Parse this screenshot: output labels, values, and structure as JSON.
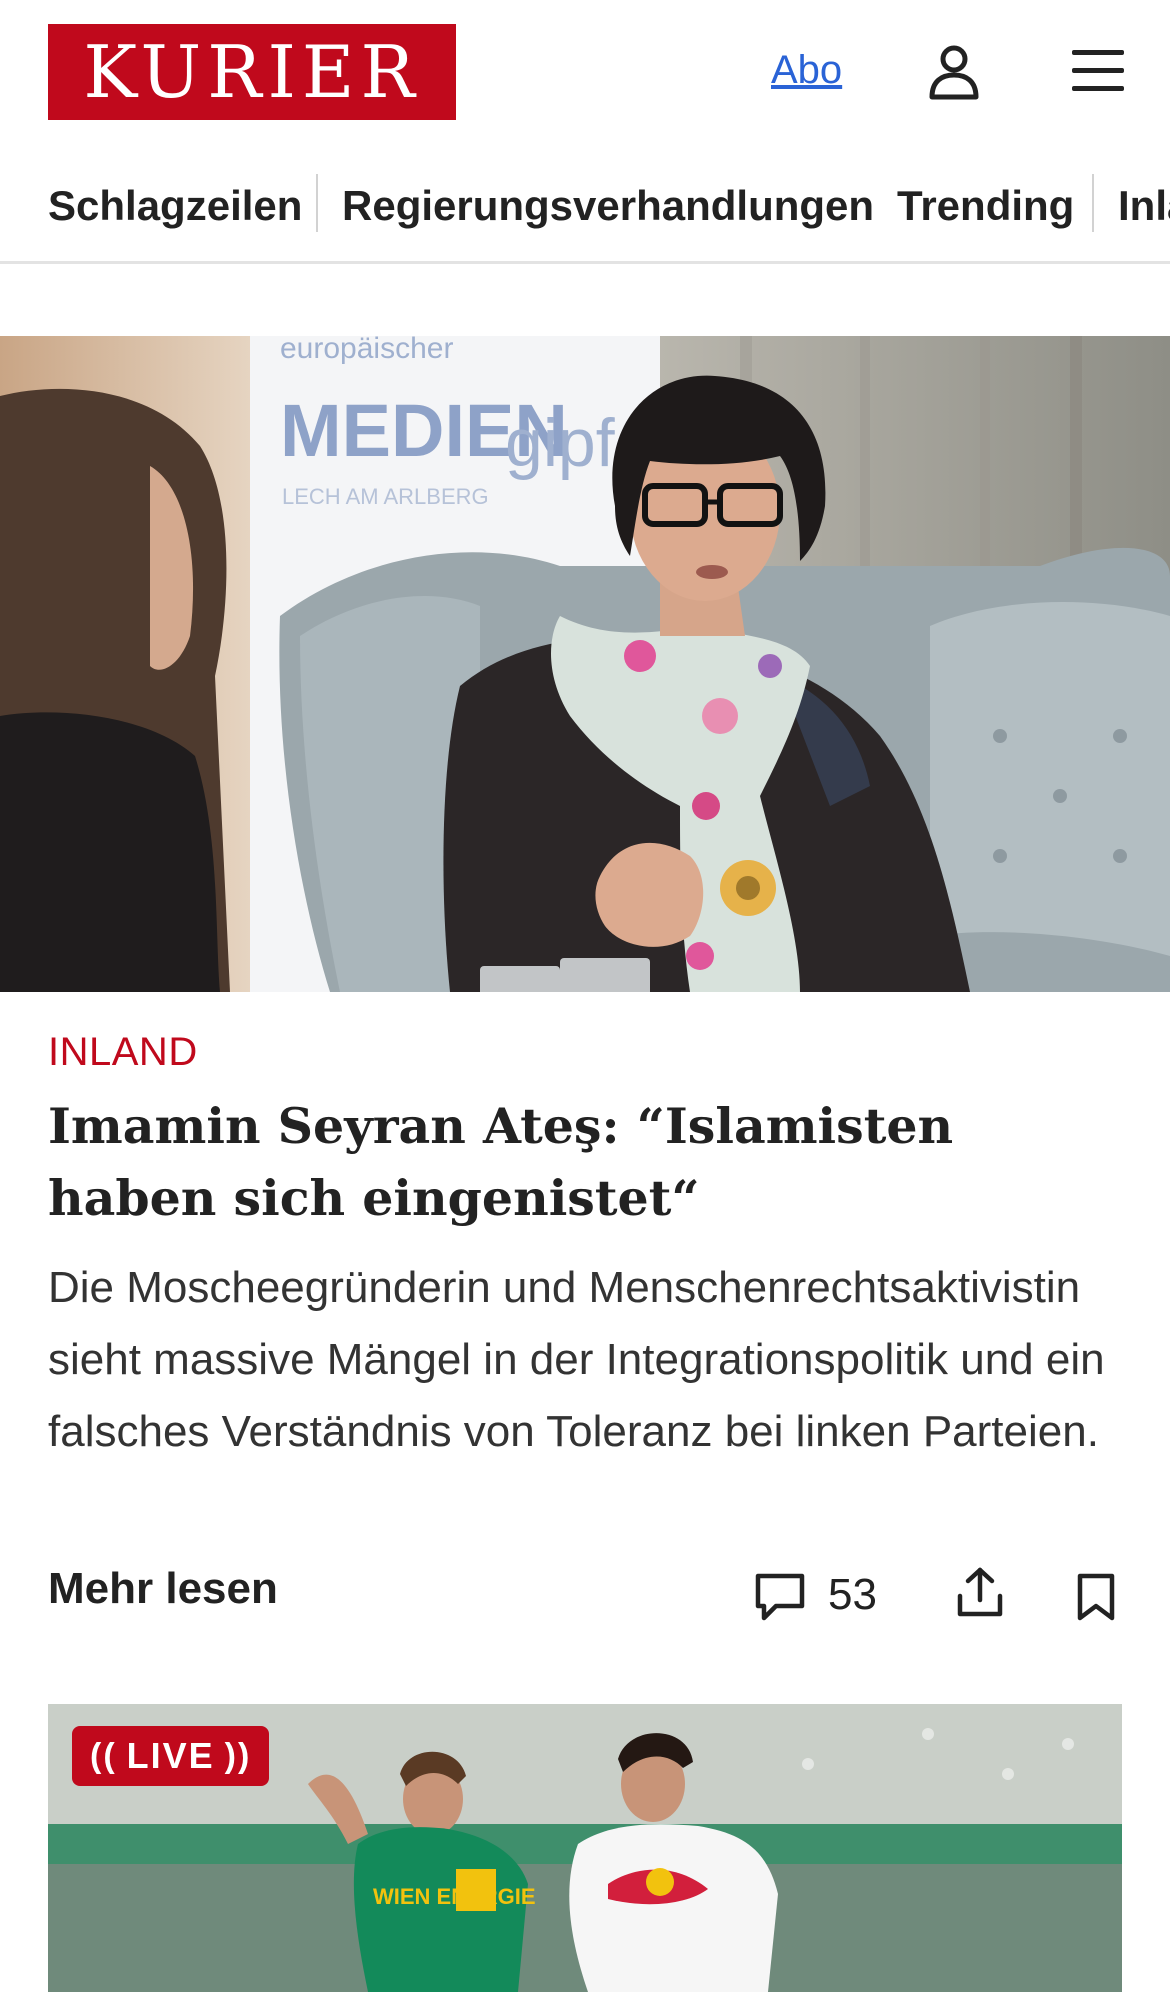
{
  "header": {
    "logo_text": "KURIER",
    "abo_label": "Abo",
    "account_icon": "user-icon",
    "menu_icon": "hamburger-menu-icon"
  },
  "nav": {
    "items": [
      {
        "label": "Schlagzeilen"
      },
      {
        "label": "Regierungsverhandlungen"
      },
      {
        "label": "Trending"
      },
      {
        "label": "Inland"
      }
    ]
  },
  "article": {
    "image_alt": "Seyran Ateş beim Europäischen Mediengipfel",
    "image_backdrop_text": "europäischer MEDIENgipfel LECH AM ARLBERG",
    "section": "INLAND",
    "headline": "Imamin Seyran Ateş: “Islamisten haben sich eingenistet“",
    "teaser": "Die Moscheegründerin und Menschenrechtsaktivistin sieht massive Mängel in der Integrationspolitik und ein falsches Verständnis von Toleranz bei linken Parteien.",
    "more_label": "Mehr lesen",
    "comment_count": "53",
    "comment_icon": "comment-icon",
    "share_icon": "share-icon",
    "bookmark_icon": "bookmark-icon"
  },
  "next_card": {
    "live_label": "LIVE",
    "jersey_text": "WIEN ENERGIE"
  },
  "colors": {
    "brand_red": "#c0091c",
    "link_blue": "#2a63d6",
    "text": "#222222"
  }
}
